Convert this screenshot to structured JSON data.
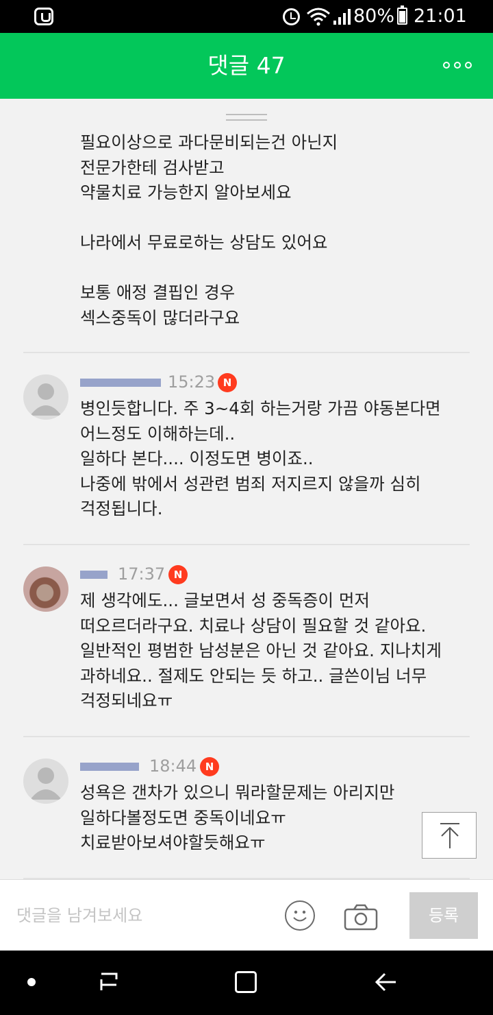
{
  "status_bar": {
    "battery": "80%",
    "time": "21:01",
    "icons": [
      "app-notification-icon",
      "alarm-icon",
      "wifi-icon",
      "signal-icon",
      "battery-icon"
    ]
  },
  "header": {
    "title": "댓글 47",
    "more_icon": "more-dots-icon"
  },
  "comments": [
    {
      "id": "partial",
      "text": "필요이상으로 과다문비되는건 아닌지\n전문가한테 검사받고\n약물치료 가능한지 알아보세요\n\n나라에서 무료로하는 상담도 있어요\n\n보통 애정 결핍인 경우\n섹스중독이 많더라구요"
    },
    {
      "id": "c1",
      "time": "15:23",
      "badge": "N",
      "avatar": "default-avatar",
      "text": "병인듯합니다. 주 3~4회 하는거랑 가끔 야동본다면\n어느정도 이해하는데..\n일하다 본다.... 이정도면 병이죠..\n나중에 밖에서 성관련 범죄 저지르지 않을까 심히\n걱정됩니다."
    },
    {
      "id": "c2",
      "time": "17:37",
      "badge": "N",
      "avatar": "photo-avatar",
      "text": "제 생각에도... 글보면서 성 중독증이 먼저\n떠오르더라구요. 치료나 상담이 필요할 것 같아요.\n일반적인 평범한 남성분은 아닌 것 같아요. 지나치게\n과하네요.. 절제도 안되는 듯 하고.. 글쓴이님 너무\n걱정되네요ㅠ"
    },
    {
      "id": "c3",
      "time": "18:44",
      "badge": "N",
      "avatar": "default-avatar",
      "text": "성욕은 갠차가 있으니 뭐라할문제는 아리지만\n일하다볼정도면 중독이네요ㅠ\n치료받아보셔야할듯해요ㅠ"
    }
  ],
  "input_bar": {
    "placeholder": "댓글을 남겨보세요",
    "submit_label": "등록",
    "icons": [
      "emoji-icon",
      "camera-icon"
    ]
  },
  "colors": {
    "brand_green": "#03c75a",
    "badge_red": "#ff3b1f"
  }
}
